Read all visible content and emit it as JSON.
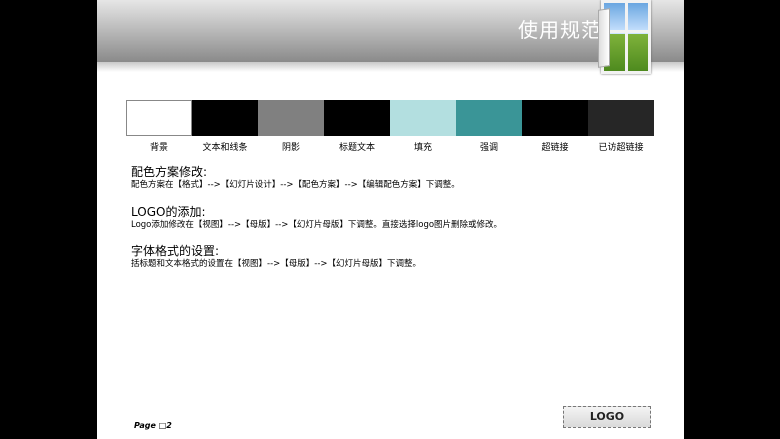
{
  "slide": {
    "title": "使用规范说明",
    "page_label": "Page",
    "page_number": "2"
  },
  "swatches": [
    {
      "label": "背景",
      "color": "#ffffff"
    },
    {
      "label": "文本和线条",
      "color": "#000000"
    },
    {
      "label": "阴影",
      "color": "#808080"
    },
    {
      "label": "标题文本",
      "color": "#000000"
    },
    {
      "label": "填充",
      "color": "#b3dfe0"
    },
    {
      "label": "强调",
      "color": "#3a9597"
    },
    {
      "label": "超链接",
      "color": "#000000"
    },
    {
      "label": "已访超链接",
      "color": "#262626"
    }
  ],
  "sections": [
    {
      "heading": "配色方案修改:",
      "body": "配色方案在【格式】-->【幻灯片设计】-->【配色方案】-->【编辑配色方案】下调整。"
    },
    {
      "heading": "LOGO的添加:",
      "body": "Logo添加修改在【视图】-->【母版】-->【幻灯片母版】下调整。直接选择logo图片删除或修改。"
    },
    {
      "heading": "字体格式的设置:",
      "body": "括标题和文本格式的设置在【视图】-->【母版】-->【幻灯片母版】下调整。"
    }
  ],
  "logo": {
    "text": "LOGO"
  },
  "icons": {
    "window": "window-image-icon"
  }
}
